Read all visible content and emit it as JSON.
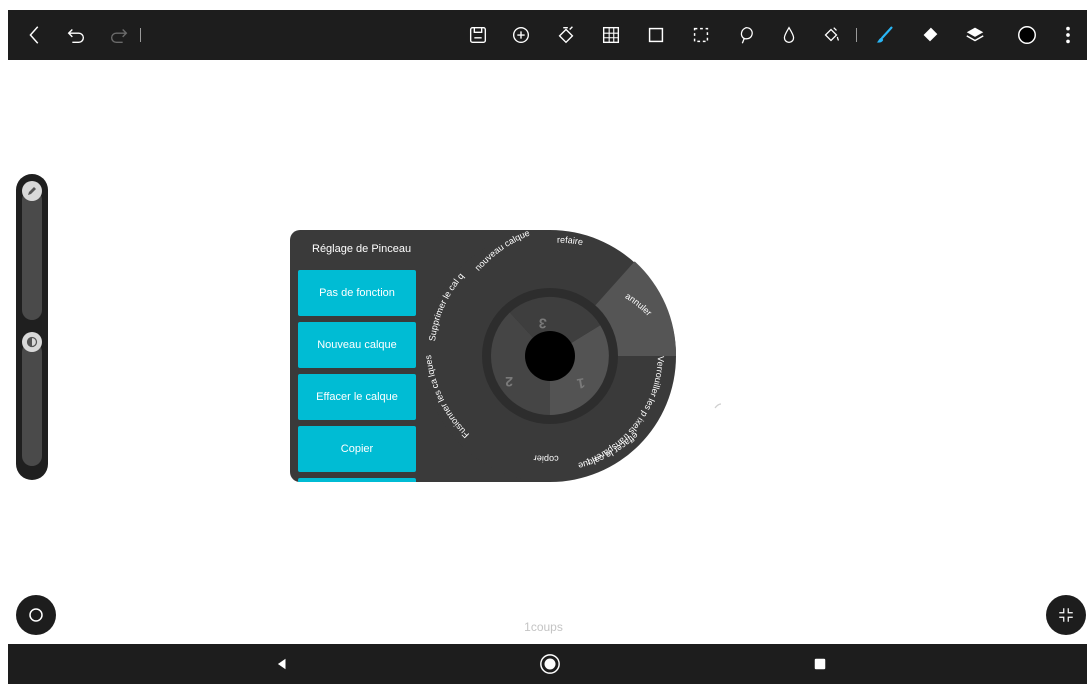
{
  "toolbar": {
    "icons": [
      "back-icon",
      "undo-icon",
      "redo-icon",
      "save-icon",
      "add-icon",
      "transform-icon",
      "grid-icon",
      "crop-icon",
      "selection-icon",
      "lasso-icon",
      "blur-icon",
      "fill-icon",
      "brush-icon",
      "eraser-icon",
      "layers-icon",
      "color-icon",
      "more-icon"
    ],
    "accent": "#29b6f6"
  },
  "brush_panel": {
    "title": "Réglage de Pinceau",
    "buttons": [
      "Pas de fonction",
      "Nouveau calque",
      "Effacer le calque",
      "Copier"
    ]
  },
  "wheel": {
    "outer_segments": [
      "nouveau calque",
      "refaire",
      "annuler",
      "Verrouiller les p ixels transparen ts",
      "effacer le calque",
      "copier",
      "Fusionner les ca lques",
      "Supprimer le cal que"
    ],
    "inner_numbers": [
      "1",
      "2",
      "3"
    ]
  },
  "status": {
    "strokes": "1coups"
  },
  "nav": {
    "icons": [
      "back-triangle-icon",
      "home-circle-icon",
      "recents-square-icon"
    ]
  }
}
